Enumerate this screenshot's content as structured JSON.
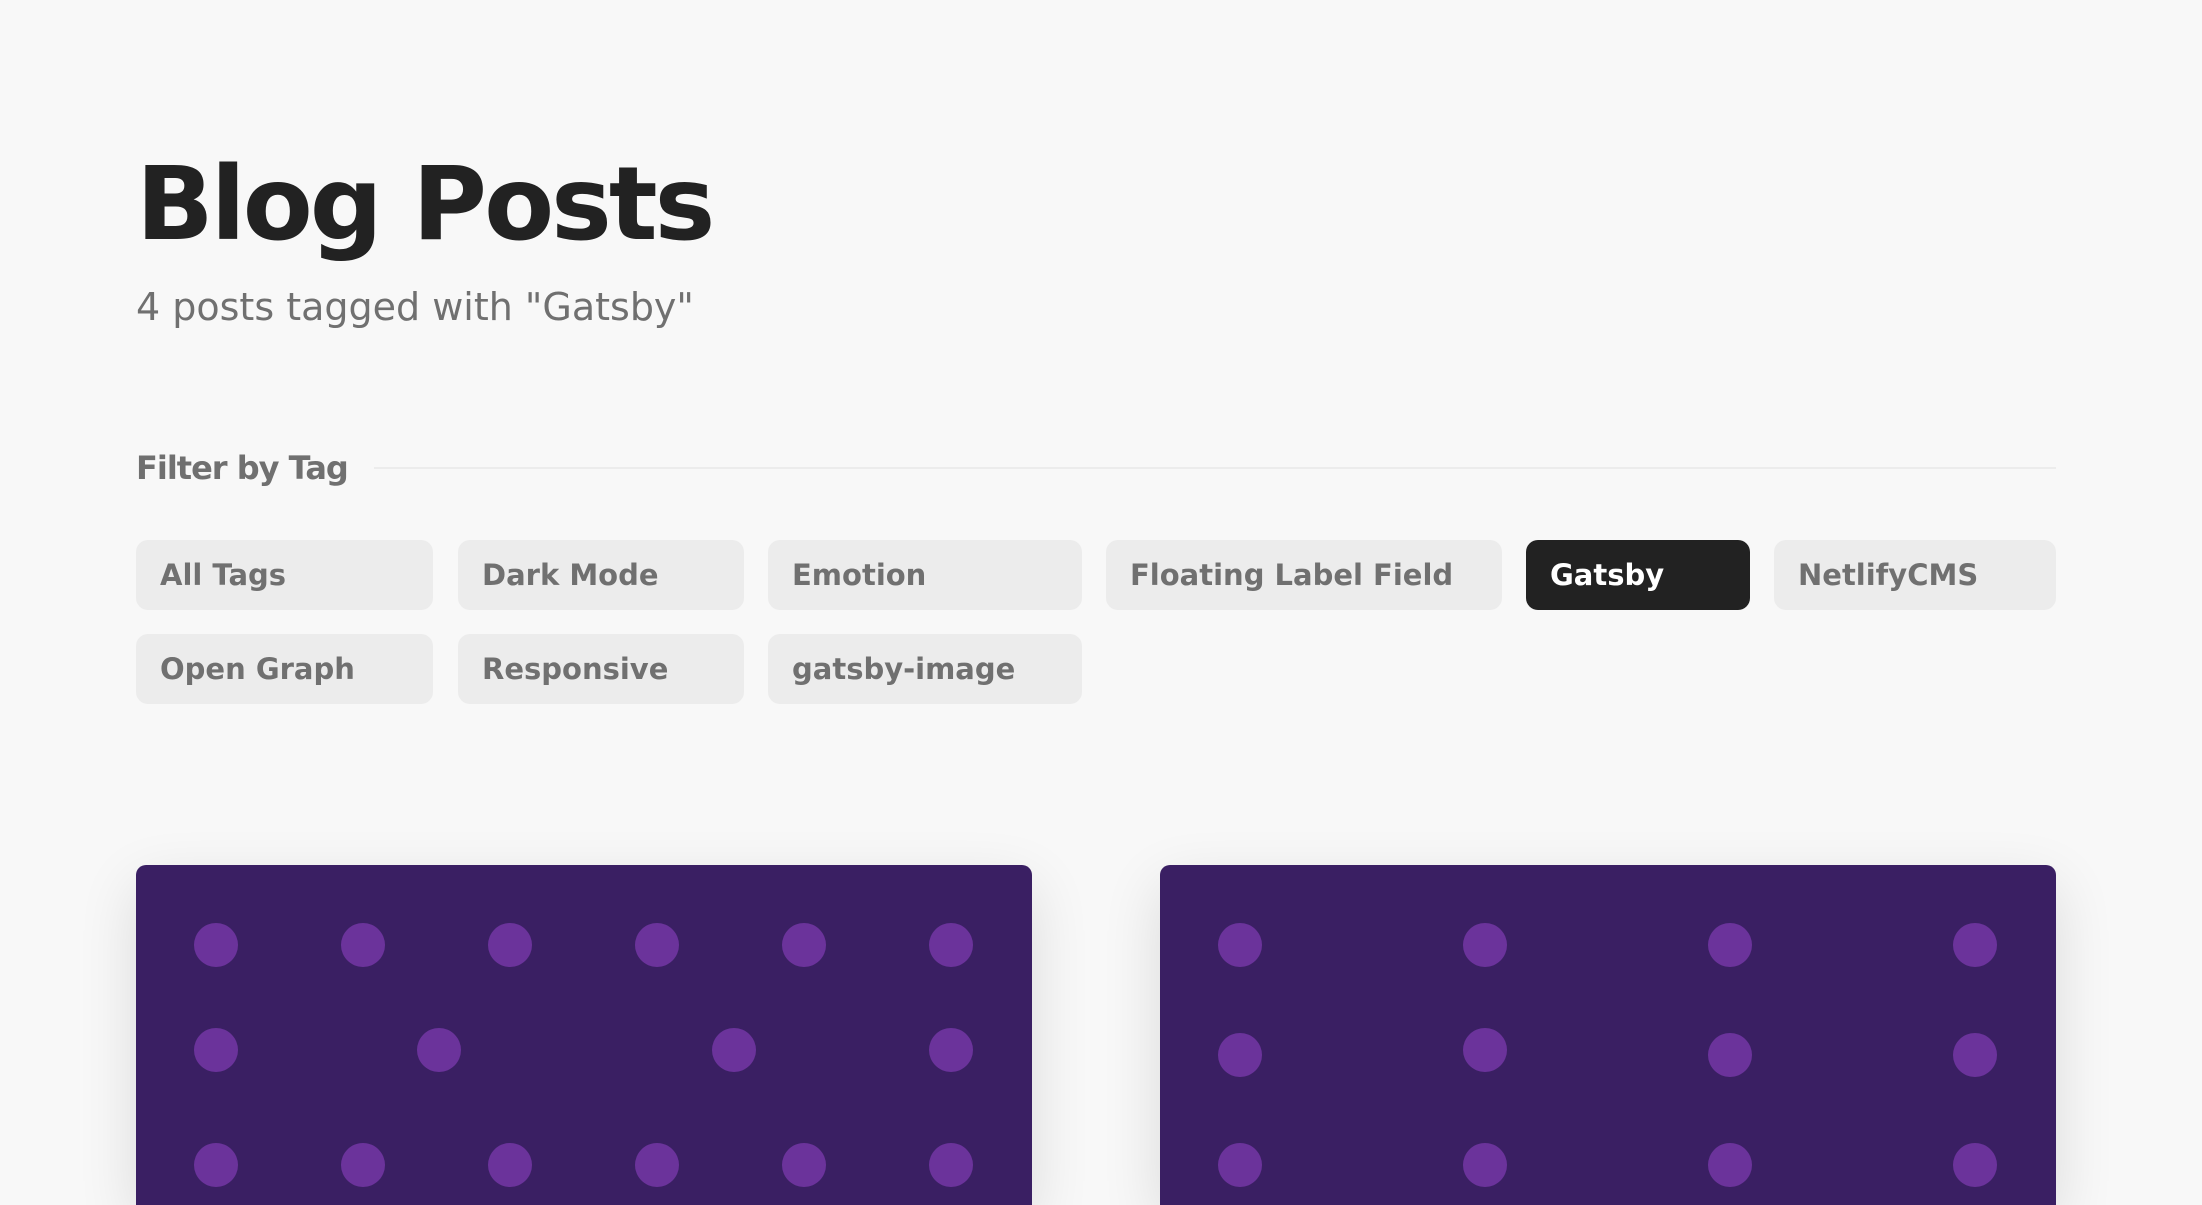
{
  "header": {
    "title": "Blog Posts",
    "subtitle": "4 posts tagged with \"Gatsby\""
  },
  "filter": {
    "heading": "Filter by Tag",
    "tags": [
      {
        "label": "All Tags",
        "active": false
      },
      {
        "label": "Dark Mode",
        "active": false
      },
      {
        "label": "Emotion",
        "active": false
      },
      {
        "label": "Floating Label Field",
        "active": false
      },
      {
        "label": "Gatsby",
        "active": true
      },
      {
        "label": "NetlifyCMS",
        "active": false
      },
      {
        "label": "Open Graph",
        "active": false
      },
      {
        "label": "Responsive",
        "active": false
      },
      {
        "label": "gatsby-image",
        "active": false
      }
    ]
  },
  "colors": {
    "background": "#f8f8f8",
    "card_background": "#3a1f63",
    "card_dot": "#6b339b",
    "tag_background": "#ececec",
    "tag_active_background": "#222222"
  },
  "cards": [
    {
      "image": "gatsby-pattern-image"
    },
    {
      "image": "gatsby-pattern-image"
    }
  ]
}
